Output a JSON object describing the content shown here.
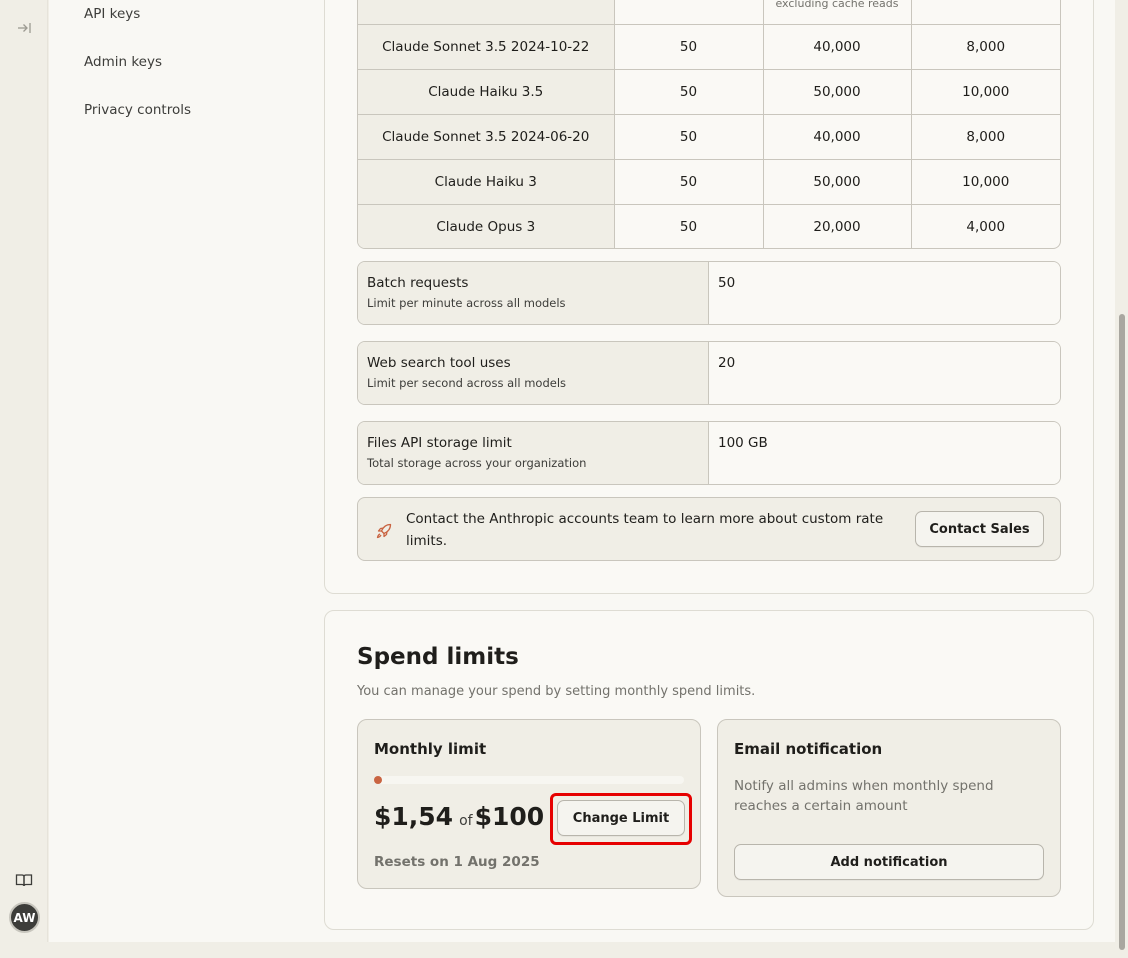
{
  "sidebar": {
    "items": [
      {
        "label": "API keys"
      },
      {
        "label": "Admin keys"
      },
      {
        "label": "Privacy controls"
      }
    ]
  },
  "user": {
    "initials": "AW"
  },
  "rate_table": {
    "header_note": "excluding cache reads",
    "rows": [
      {
        "model": "Claude Sonnet 3.5 2024-10-22",
        "rpm": "50",
        "input_tpm": "40,000",
        "output_tpm": "8,000"
      },
      {
        "model": "Claude Haiku 3.5",
        "rpm": "50",
        "input_tpm": "50,000",
        "output_tpm": "10,000"
      },
      {
        "model": "Claude Sonnet 3.5 2024-06-20",
        "rpm": "50",
        "input_tpm": "40,000",
        "output_tpm": "8,000"
      },
      {
        "model": "Claude Haiku 3",
        "rpm": "50",
        "input_tpm": "50,000",
        "output_tpm": "10,000"
      },
      {
        "model": "Claude Opus 3",
        "rpm": "50",
        "input_tpm": "20,000",
        "output_tpm": "4,000"
      }
    ]
  },
  "limits": {
    "batch": {
      "title": "Batch requests",
      "subtitle": "Limit per minute across all models",
      "value": "50"
    },
    "web_search": {
      "title": "Web search tool uses",
      "subtitle": "Limit per second across all models",
      "value": "20"
    },
    "files": {
      "title": "Files API storage limit",
      "subtitle": "Total storage across your organization",
      "value": "100 GB"
    }
  },
  "contact": {
    "message": "Contact the Anthropic accounts team to learn more about custom rate limits.",
    "button_label": "Contact Sales"
  },
  "spend": {
    "title": "Spend limits",
    "subtitle": "You can manage your spend by setting monthly spend limits.",
    "monthly": {
      "title": "Monthly limit",
      "current": "$1,54",
      "of_label": "of",
      "limit": "$100",
      "progress_fraction": 0.0154,
      "button_label": "Change Limit",
      "resets": "Resets on 1 Aug 2025"
    },
    "email": {
      "title": "Email notification",
      "description": "Notify all admins when monthly spend reaches a certain amount",
      "button_label": "Add notification"
    }
  },
  "colors": {
    "accent": "#c96442",
    "highlight": "#e60000"
  },
  "icons": {
    "expand": "arrow-right-to-line-icon",
    "docs": "book-open-icon",
    "rocket": "rocket-icon"
  }
}
